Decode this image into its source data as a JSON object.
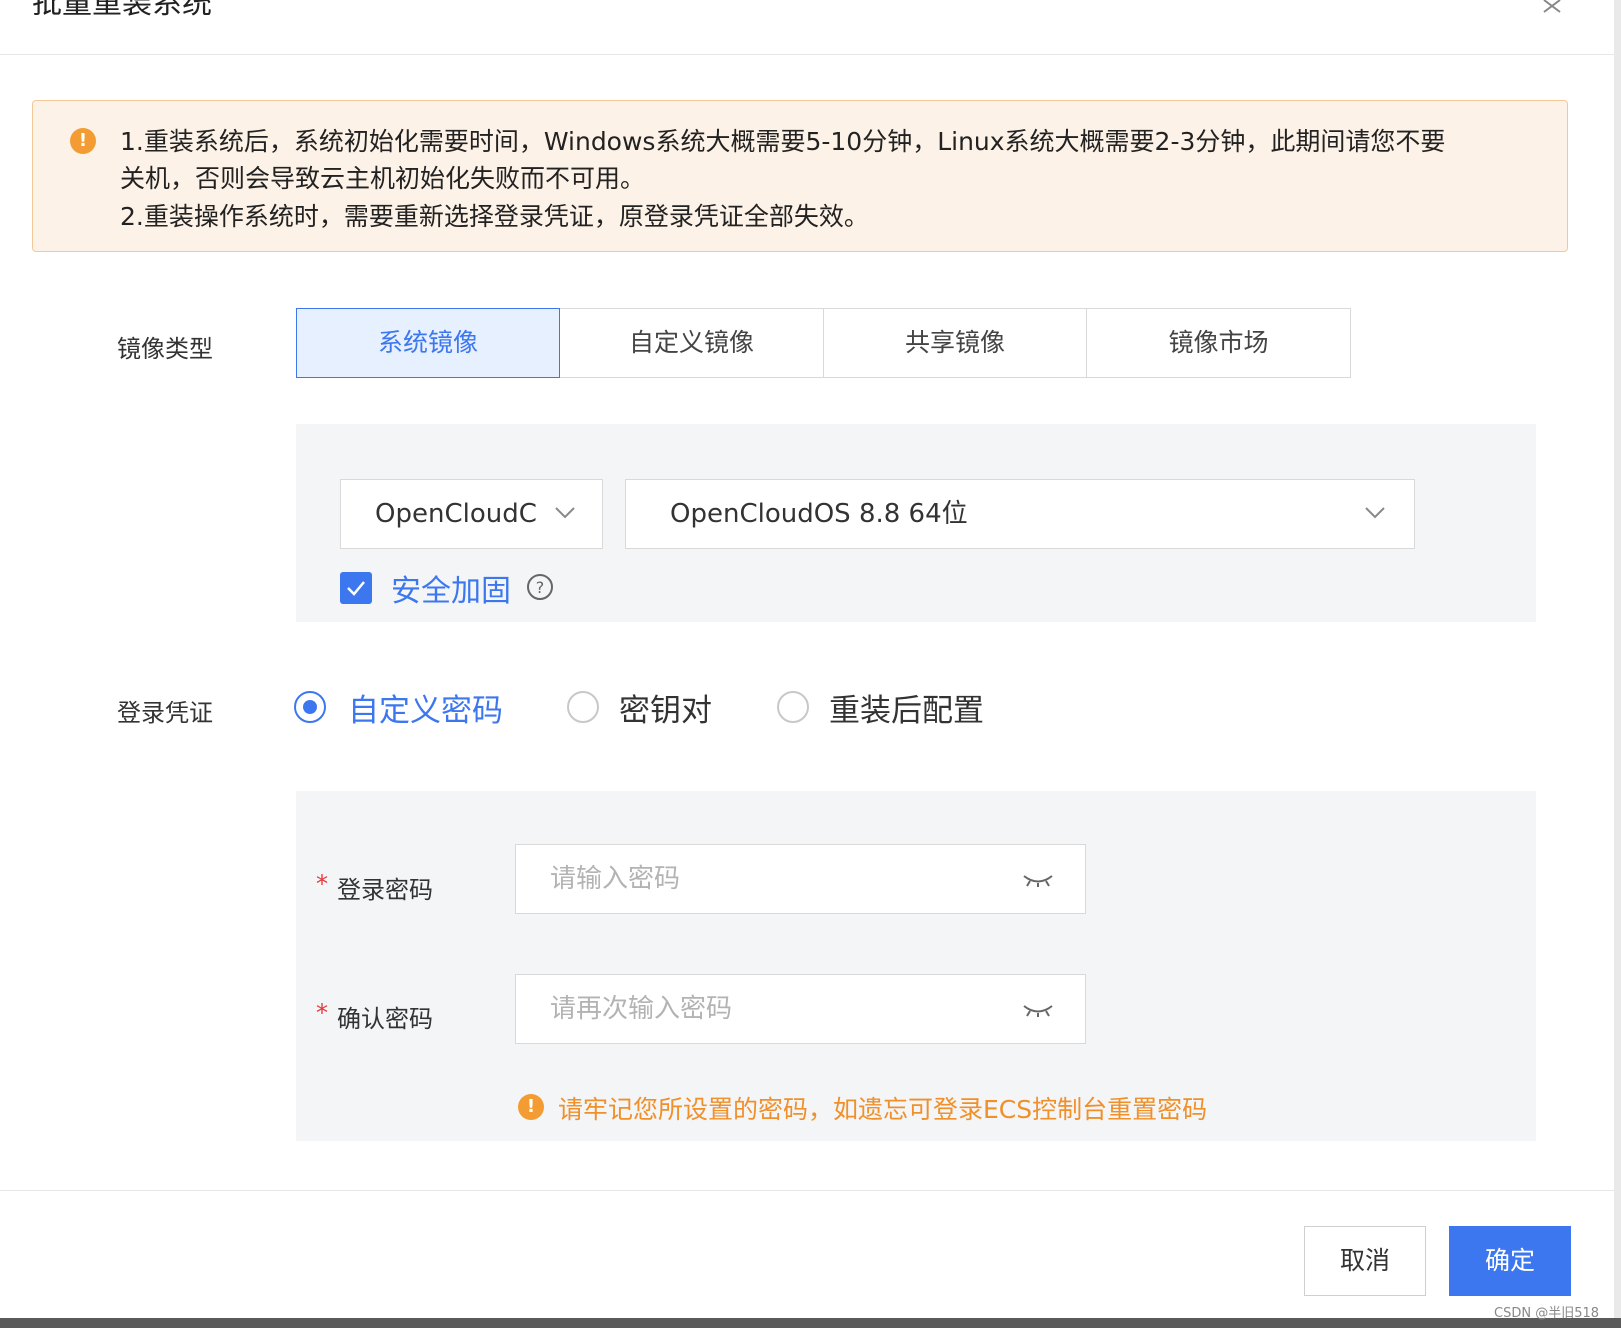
{
  "dialog": {
    "title": "批量重装系统"
  },
  "alert": {
    "line1": "1.重装系统后，系统初始化需要时间，Windows系统大概需要5-10分钟，Linux系统大概需要2-3分钟，此期间请您不要",
    "line2": "关机，否则会导致云主机初始化失败而不可用。",
    "line3": "2.重装操作系统时，需要重新选择登录凭证，原登录凭证全部失效。"
  },
  "image_type": {
    "label": "镜像类型",
    "tabs": [
      "系统镜像",
      "自定义镜像",
      "共享镜像",
      "镜像市场"
    ],
    "selected": "系统镜像"
  },
  "image_select": {
    "os_family": "OpenCloudC",
    "os_version": "OpenCloudOS 8.8 64位",
    "security_label": "安全加固",
    "security_checked": true
  },
  "login": {
    "label": "登录凭证",
    "options": [
      "自定义密码",
      "密钥对",
      "重装后配置"
    ],
    "selected": "自定义密码",
    "password_label": "登录密码",
    "password_placeholder": "请输入密码",
    "confirm_label": "确认密码",
    "confirm_placeholder": "请再次输入密码",
    "required_mark": "*",
    "tip": "请牢记您所设置的密码，如遗忘可登录ECS控制台重置密码"
  },
  "footer": {
    "cancel_label": "取消",
    "ok_label": "确定",
    "watermark": "CSDN @半旧518"
  },
  "colors": {
    "primary": "#3d77ef",
    "warning": "#f39c34",
    "alert_bg": "#fdf2e7"
  },
  "icons": {
    "close": "close-icon",
    "alert": "exclamation-circle-icon",
    "chevron": "chevron-down-icon",
    "help": "question-circle-icon",
    "eye": "eye-closed-icon",
    "check": "check-icon"
  }
}
